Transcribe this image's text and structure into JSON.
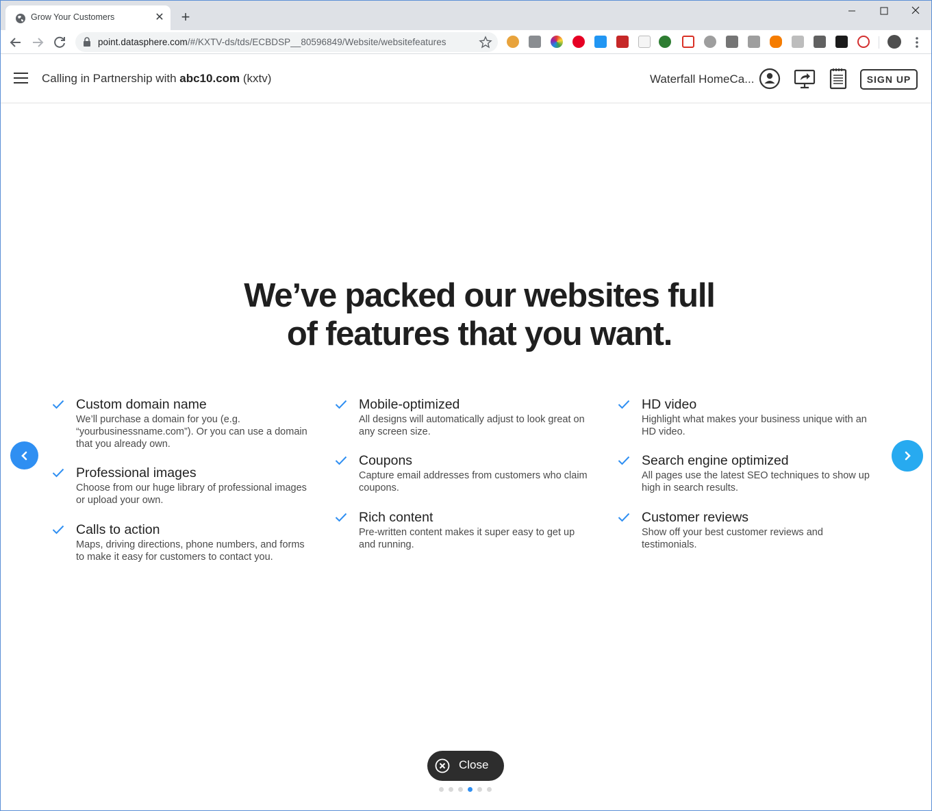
{
  "browser": {
    "tab_title": "Grow Your Customers",
    "tab_close": "✕",
    "new_tab": "+",
    "url_host": "point.datasphere.com",
    "url_path": "/#/KXTV-ds/tds/ECBDSP__80596849/Website/websitefeatures"
  },
  "header": {
    "partner_prefix": "Calling in Partnership with ",
    "partner_name": "abc10.com",
    "partner_suffix": " (kxtv)",
    "business_name": "Waterfall HomeCa...",
    "signup_label": "SIGN UP"
  },
  "slide": {
    "headline_line1": "We’ve packed our websites full",
    "headline_line2": "of features that you want.",
    "features": [
      {
        "title": "Custom domain name",
        "desc": "We’ll purchase a domain for you (e.g. “yourbusinessname.com”). Or you can use a domain that you already own."
      },
      {
        "title": "Professional images",
        "desc": "Choose from our huge library of professional images or upload your own."
      },
      {
        "title": "Calls to action",
        "desc": "Maps, driving directions, phone numbers, and forms to make it easy for customers to contact you."
      },
      {
        "title": "Mobile-optimized",
        "desc": "All designs will automatically adjust to look great on any screen size."
      },
      {
        "title": "Coupons",
        "desc": "Capture email addresses from customers who claim coupons."
      },
      {
        "title": "Rich content",
        "desc": "Pre-written content makes it super easy to get up and running."
      },
      {
        "title": "HD video",
        "desc": "Highlight what makes your business unique with an HD video."
      },
      {
        "title": "Search engine optimized",
        "desc": "All pages use the latest SEO techniques to show up high in search results."
      },
      {
        "title": "Customer reviews",
        "desc": "Show off your best customer reviews and testimonials."
      }
    ],
    "close_label": "Close",
    "pagination": {
      "total": 6,
      "current": 4
    }
  },
  "colors": {
    "accent": "#2f8ff2",
    "next_arrow": "#27aaf0",
    "check": "#2f8ff2",
    "close_bg": "#2d2d2d"
  }
}
